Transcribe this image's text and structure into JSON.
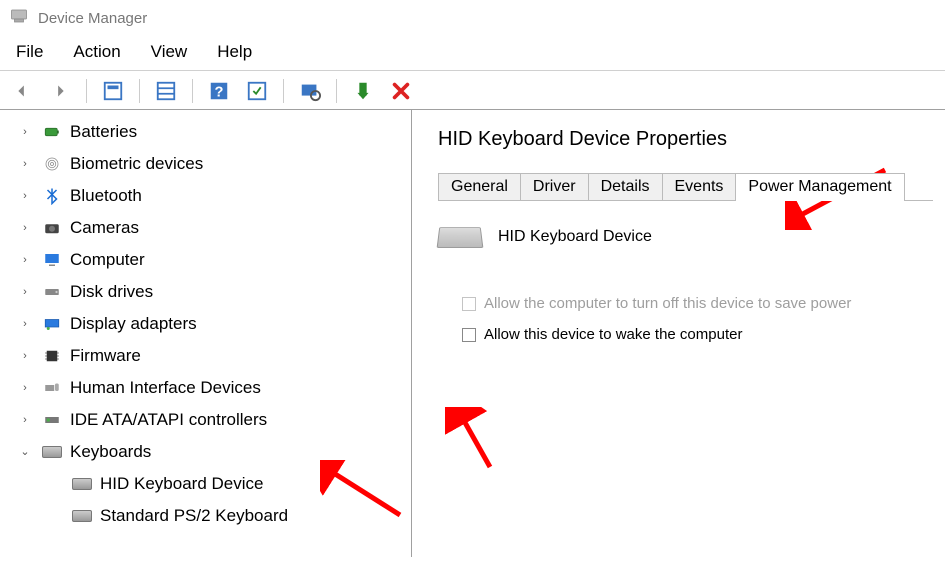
{
  "window": {
    "title": "Device Manager"
  },
  "menu": {
    "file": "File",
    "action": "Action",
    "view": "View",
    "help": "Help"
  },
  "tree": [
    {
      "expand": "collapsed",
      "icon": "battery",
      "label": "Batteries"
    },
    {
      "expand": "collapsed",
      "icon": "biometric",
      "label": "Biometric devices"
    },
    {
      "expand": "collapsed",
      "icon": "bluetooth",
      "label": "Bluetooth"
    },
    {
      "expand": "collapsed",
      "icon": "camera",
      "label": "Cameras"
    },
    {
      "expand": "collapsed",
      "icon": "computer",
      "label": "Computer"
    },
    {
      "expand": "collapsed",
      "icon": "disk",
      "label": "Disk drives"
    },
    {
      "expand": "collapsed",
      "icon": "display",
      "label": "Display adapters"
    },
    {
      "expand": "collapsed",
      "icon": "firmware",
      "label": "Firmware"
    },
    {
      "expand": "collapsed",
      "icon": "hid",
      "label": "Human Interface Devices"
    },
    {
      "expand": "collapsed",
      "icon": "ide",
      "label": "IDE ATA/ATAPI controllers"
    },
    {
      "expand": "expanded",
      "icon": "keyboard",
      "label": "Keyboards"
    }
  ],
  "keyboards_children": [
    {
      "icon": "keyboard",
      "label": "HID Keyboard Device"
    },
    {
      "icon": "keyboard",
      "label": "Standard PS/2 Keyboard"
    }
  ],
  "properties": {
    "title": "HID Keyboard Device Properties",
    "tabs": {
      "general": "General",
      "driver": "Driver",
      "details": "Details",
      "events": "Events",
      "power": "Power Management"
    },
    "active_tab": "power",
    "device_name": "HID Keyboard Device",
    "checkbox_turnoff": "Allow the computer to turn off this device to save power",
    "checkbox_wake": "Allow this device to wake the computer"
  }
}
